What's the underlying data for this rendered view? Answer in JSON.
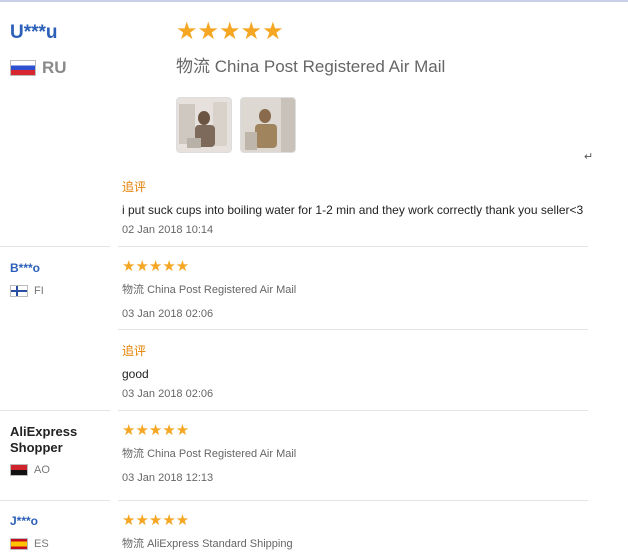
{
  "reviews": [
    {
      "buyer": "U***u",
      "country": "RU",
      "stars": "★★★★★",
      "ship_prefix": "物流",
      "shipping": "China Post Registered Air Mail",
      "photos": [
        "photo-1",
        "photo-2"
      ],
      "followup_label": "追评",
      "followup_text": "i put suck cups into boiling water for 1-2 min and they work correctly thank you seller<3",
      "followup_date": "02 Jan 2018 10:14",
      "rating": 5
    },
    {
      "buyer": "B***o",
      "country": "FI",
      "stars": "★★★★★",
      "ship_prefix": "物流",
      "shipping": "China Post Registered Air Mail",
      "date": "03 Jan 2018 02:06",
      "followup_label": "追评",
      "followup_text": "good",
      "followup_date": "03 Jan 2018 02:06",
      "rating": 5
    },
    {
      "buyer_line1": "AliExpress",
      "buyer_line2": "Shopper",
      "country": "AO",
      "stars": "★★★★★",
      "ship_prefix": "物流",
      "shipping": "China Post Registered Air Mail",
      "date": "03 Jan 2018 12:13",
      "rating": 5
    },
    {
      "buyer": "J***o",
      "country": "ES",
      "stars": "★★★★★",
      "ship_prefix": "物流",
      "shipping": "AliExpress Standard Shipping",
      "rating": 5
    }
  ],
  "misc": {
    "return_mark": "↵"
  },
  "colors": {
    "accent_star": "#f5a623",
    "buyer_link": "#2b5fb8",
    "followup": "#e57f00"
  }
}
